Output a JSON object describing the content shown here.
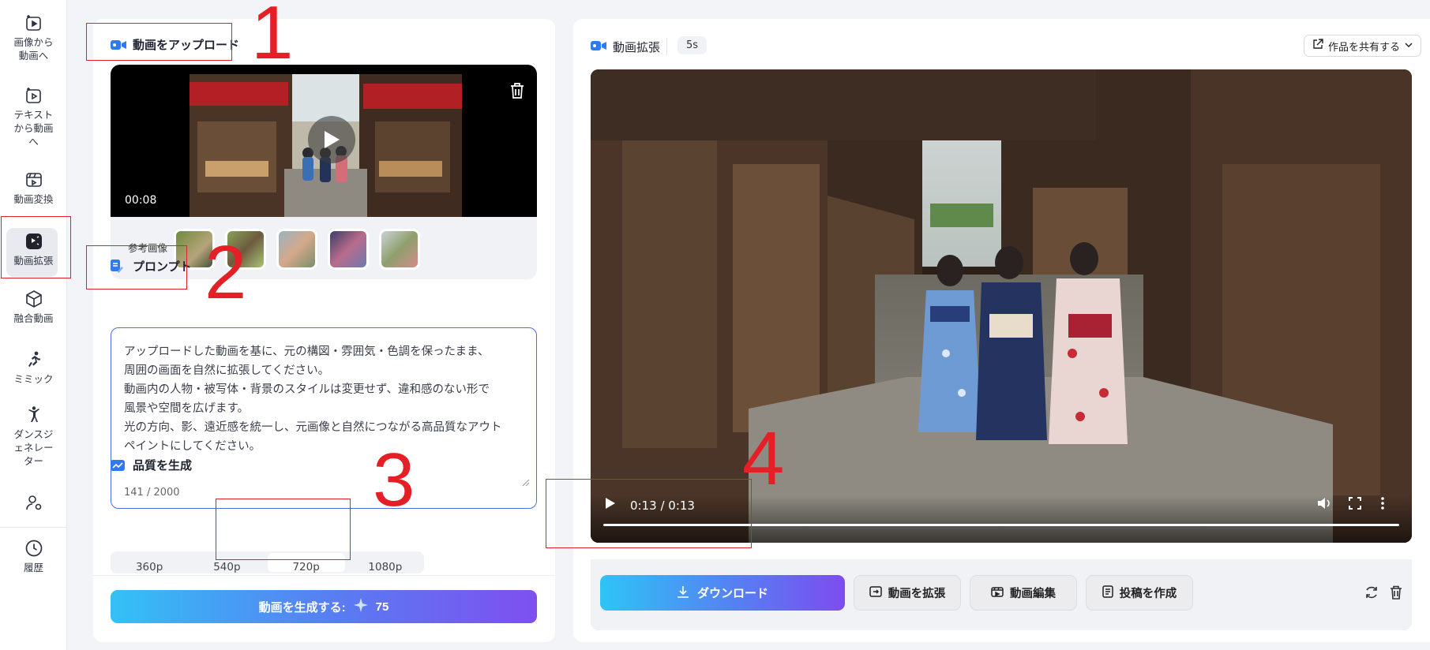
{
  "sidebar": {
    "items": [
      {
        "label": "画像から\n動画へ",
        "icon": "image-to-video-icon"
      },
      {
        "label": "テキスト\nから動画\nへ",
        "icon": "text-to-video-icon"
      },
      {
        "label": "動画変換",
        "icon": "video-convert-icon"
      },
      {
        "label": "動画拡張",
        "icon": "video-extend-icon",
        "active": true
      },
      {
        "label": "融合動画",
        "icon": "fusion-icon"
      },
      {
        "label": "ミミック",
        "icon": "runner-icon"
      },
      {
        "label": "ダンスジ\nェネレー\nター",
        "icon": "dancer-icon"
      },
      {
        "label": "",
        "icon": "user-settings-icon"
      },
      {
        "label": "履歴",
        "icon": "clock-icon"
      }
    ]
  },
  "upload": {
    "title": "動画をアップロード",
    "time": "00:08",
    "ref_label": "参考画像",
    "ref_count": 5
  },
  "prompt": {
    "title": "プロンプト",
    "text": "アップロードした動画を基に、元の構図・雰囲気・色調を保ったまま、\n周囲の画面を自然に拡張してください。\n動画内の人物・被写体・背景のスタイルは変更せず、違和感のない形で\n風景や空間を広げます。\n光の方向、影、遠近感を統一し、元画像と自然につながる高品質なアウト\nペイントにしてください。",
    "count": "141 / 2000"
  },
  "quality": {
    "title": "品質を生成",
    "options": [
      "360p",
      "540p",
      "720p",
      "1080p"
    ],
    "selected": "720p"
  },
  "generate": {
    "label": "動画を生成する:",
    "credits": "75"
  },
  "result": {
    "title": "動画拡張",
    "duration": "5s",
    "share_label": "作品を共有する",
    "player_time": "0:13 / 0:13",
    "progress": 1.0,
    "download_label": "ダウンロード",
    "extend_label": "動画を拡張",
    "edit_label": "動画編集",
    "post_label": "投稿を作成"
  },
  "annotations": [
    "1",
    "2",
    "3",
    "4"
  ],
  "colors": {
    "accent": "#4d6ce6",
    "gradient_start": "#33c1f5",
    "gradient_end": "#7f4ff0",
    "annotation": "#e0202a"
  }
}
